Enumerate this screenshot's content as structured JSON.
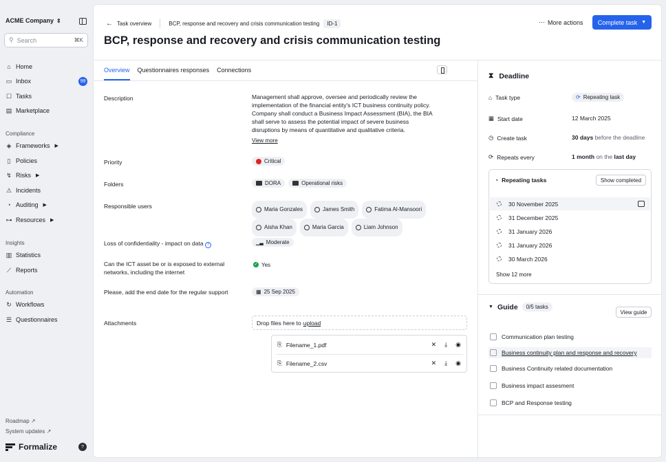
{
  "sidebar": {
    "company": "ACME Company",
    "search_placeholder": "Search",
    "search_shortcut": "⌘K",
    "items_top": [
      {
        "label": "Home",
        "icon": "home-icon"
      },
      {
        "label": "Inbox",
        "icon": "inbox-icon",
        "badge": "99"
      },
      {
        "label": "Tasks",
        "icon": "tasks-icon"
      },
      {
        "label": "Marketplace",
        "icon": "marketplace-icon"
      }
    ],
    "section_compliance": "Compliance",
    "items_compliance": [
      {
        "label": "Frameworks"
      },
      {
        "label": "Policies"
      },
      {
        "label": "Risks"
      },
      {
        "label": "Incidents"
      },
      {
        "label": "Auditing"
      },
      {
        "label": "Resources"
      }
    ],
    "section_insights": "Insights",
    "items_insights": [
      {
        "label": "Statistics"
      },
      {
        "label": "Reports"
      }
    ],
    "section_automation": "Automation",
    "items_automation": [
      {
        "label": "Workflows"
      },
      {
        "label": "Questionnaires"
      }
    ],
    "roadmap": "Roadmap",
    "system_updates": "System updates",
    "brand": "Formalize",
    "help": "?"
  },
  "header": {
    "back_label": "Task overview",
    "breadcrumb_title": "BCP, response and recovery and crisis communication testing",
    "id_badge": "ID-1",
    "more_actions": "More actions",
    "complete_task": "Complete task",
    "title": "BCP, response and recovery and crisis communication testing"
  },
  "tabs": [
    "Overview",
    "Questionnaires responses",
    "Connections"
  ],
  "fields": {
    "description_label": "Description",
    "description": "Management shall approve, oversee and periodically review the implementation of the financial entity's ICT business continuity policy. Company shall conduct a Business Impact Assessment (BIA), the BIA shall serve to assess the potential impact of severe business disruptions by means of quantitative and qualitative criteria.",
    "view_more": "View more",
    "priority_label": "Priority",
    "priority": "Critical",
    "folders_label": "Folders",
    "folders": [
      "DORA",
      "Operational risks"
    ],
    "responsible_label": "Responsible users",
    "users": [
      "Maria Gonzales",
      "James Smith",
      "Fatima Al-Mansoori",
      "Aisha Khan",
      "Maria Garcia",
      "Liam Johnson"
    ],
    "loss_label": "Loss of confidentiality - impact on data",
    "loss": "Moderate",
    "ict_label": "Can the ICT asset be or is exposed to external networks, including the internet",
    "ict": "Yes",
    "enddate_label": "Please, add the end date for the regular support",
    "enddate": "25 Sep 2025",
    "attachments_label": "Attachments",
    "drop_text": "Drop files here to",
    "upload": "upload",
    "files": [
      "Filename_1.pdf",
      "Filename_2.csv"
    ]
  },
  "deadline": {
    "title": "Deadline",
    "task_type_label": "Task type",
    "task_type": "Repeating task",
    "start_label": "Start date",
    "start": "12 March 2025",
    "create_label": "Create task",
    "create_bold": "30 days",
    "create_rest": "before the deadline",
    "repeats_label": "Repeats every",
    "repeats_bold": "1 month",
    "repeats_mid": "on the",
    "repeats_end": "last day",
    "repeating_title": "Repeating tasks",
    "show_completed": "Show completed",
    "dates": [
      "30 November 2025",
      "31 December 2025",
      "31 January 2026",
      "31 January 2026",
      "30 March 2026"
    ],
    "show_more": "Show 12 more"
  },
  "guide": {
    "title": "Guide",
    "count": "0/5 tasks",
    "view_guide": "View guide",
    "items": [
      "Communication plan testing",
      "Business continuity plan and response and recovery",
      "Business Continuity related documentation",
      "Business impact assesment",
      "BCP and Response testing"
    ]
  },
  "colors": {
    "accent": "#2563eb",
    "critical": "#dc2626",
    "success": "#16a34a"
  }
}
